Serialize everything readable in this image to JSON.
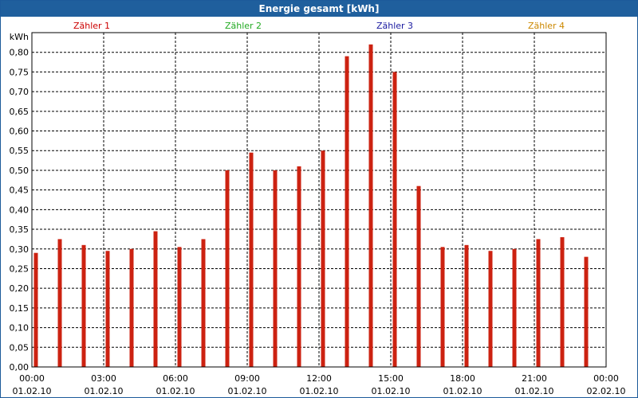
{
  "title": "Energie gesamt [kWh]",
  "legend": [
    {
      "label": "Zähler 1",
      "color": "#cc0000"
    },
    {
      "label": "Zähler 2",
      "color": "#22aa22"
    },
    {
      "label": "Zähler 3",
      "color": "#1a1aa0"
    },
    {
      "label": "Zähler 4",
      "color": "#cc8800"
    }
  ],
  "chart_data": {
    "type": "bar",
    "ylabel": "kWh",
    "ylim": [
      0,
      0.85
    ],
    "yticks": [
      "0,00",
      "0,05",
      "0,10",
      "0,15",
      "0,20",
      "0,25",
      "0,30",
      "0,35",
      "0,40",
      "0,45",
      "0,50",
      "0,55",
      "0,60",
      "0,65",
      "0,70",
      "0,75",
      "0,80"
    ],
    "xticks": [
      {
        "time": "00:00",
        "date": "01.02.10"
      },
      {
        "time": "03:00",
        "date": "01.02.10"
      },
      {
        "time": "06:00",
        "date": "01.02.10"
      },
      {
        "time": "09:00",
        "date": "01.02.10"
      },
      {
        "time": "12:00",
        "date": "01.02.10"
      },
      {
        "time": "15:00",
        "date": "01.02.10"
      },
      {
        "time": "18:00",
        "date": "01.02.10"
      },
      {
        "time": "21:00",
        "date": "01.02.10"
      },
      {
        "time": "00:00",
        "date": "02.02.10"
      }
    ],
    "grid": true,
    "series": [
      {
        "name": "Zähler 1",
        "color": "#cc2211",
        "hours": [
          0,
          1,
          2,
          3,
          4,
          5,
          6,
          7,
          8,
          9,
          10,
          11,
          12,
          13,
          14,
          15,
          16,
          17,
          18,
          19,
          20,
          21,
          22,
          23
        ],
        "values": [
          0.29,
          0.325,
          0.31,
          0.295,
          0.3,
          0.345,
          0.305,
          0.325,
          0.5,
          0.545,
          0.5,
          0.51,
          0.55,
          0.79,
          0.82,
          0.75,
          0.46,
          0.305,
          0.31,
          0.295,
          0.3,
          0.325,
          0.33,
          0.28
        ]
      }
    ]
  }
}
